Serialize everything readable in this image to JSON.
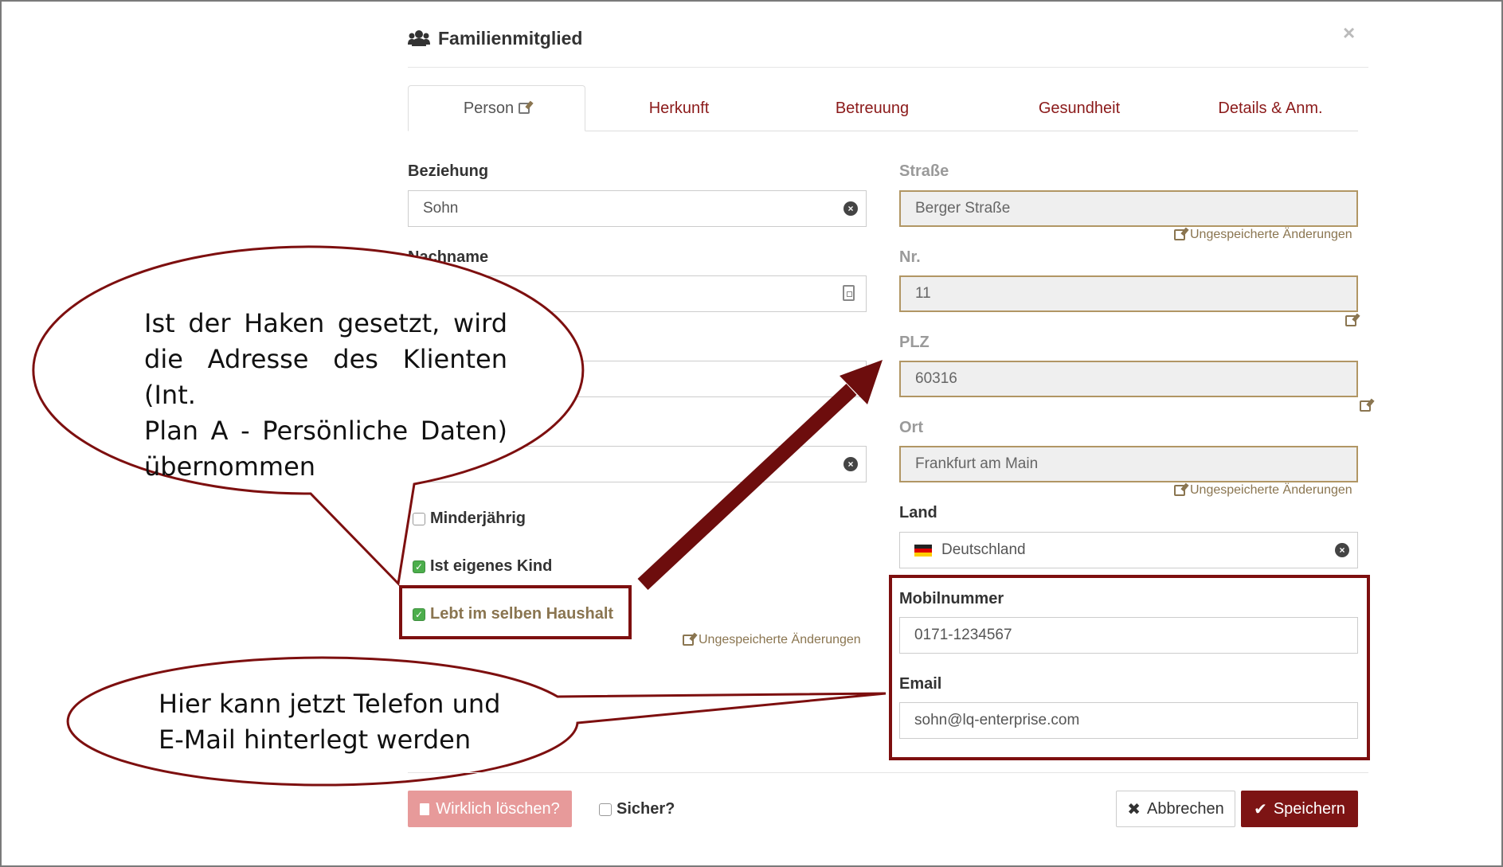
{
  "modal": {
    "title": "Familienmitglied",
    "close_label": "×"
  },
  "tabs": [
    {
      "label": "Person",
      "active": true
    },
    {
      "label": "Herkunft",
      "active": false
    },
    {
      "label": "Betreuung",
      "active": false
    },
    {
      "label": "Gesundheit",
      "active": false
    },
    {
      "label": "Details & Anm.",
      "active": false
    }
  ],
  "left": {
    "beziehung": {
      "label": "Beziehung",
      "value": "Sohn"
    },
    "nachname": {
      "label": "Nachname",
      "value": ""
    },
    "field3": {
      "value": ""
    },
    "field4": {
      "value": ""
    },
    "checkboxes": {
      "minderjaehrig": {
        "label": "Minderjährig",
        "checked": false
      },
      "eigenes_kind": {
        "label": "Ist eigenes Kind",
        "checked": true
      },
      "selber_haushalt": {
        "label": "Lebt im selben Haushalt",
        "checked": true
      }
    },
    "unsaved_hint": "Ungespeicherte Änderungen"
  },
  "right": {
    "strasse": {
      "label": "Straße",
      "value": "Berger Straße",
      "hint": "Ungespeicherte Änderungen"
    },
    "nr": {
      "label": "Nr.",
      "value": "11"
    },
    "plz": {
      "label": "PLZ",
      "value": "60316"
    },
    "ort": {
      "label": "Ort",
      "value": "Frankfurt am Main",
      "hint": "Ungespeicherte Änderungen"
    },
    "land": {
      "label": "Land",
      "value": "Deutschland"
    },
    "mobil": {
      "label": "Mobilnummer",
      "value": "0171-1234567"
    },
    "email": {
      "label": "Email",
      "value": "sohn@lq-enterprise.com"
    }
  },
  "annotations": {
    "bubble1_lines": [
      "Ist der Haken gesetzt, wird",
      "die Adresse des Klienten (Int.",
      "Plan A - Persönliche Daten)",
      "übernommen"
    ],
    "bubble2_lines": [
      "Hier kann jetzt Telefon und",
      "E-Mail hinterlegt werden"
    ]
  },
  "footer": {
    "delete_label": "Wirklich löschen?",
    "confirm_label": "Sicher?",
    "cancel_label": "Abbrechen",
    "save_label": "Speichern"
  },
  "colors": {
    "accent": "#7d1414",
    "tab_text": "#8b1a1a",
    "dirty_border": "#b19664",
    "checkbox_on": "#4cae4c",
    "delete_btn": "#e79a9a"
  },
  "icons": {
    "title_icon": "users-icon",
    "edit_icon": "edit-icon",
    "clear_icon": "clear-circle-icon",
    "flag_icon": "flag-de-icon",
    "trash_icon": "trash-icon",
    "cancel_icon": "times-icon",
    "save_icon": "check-icon"
  }
}
